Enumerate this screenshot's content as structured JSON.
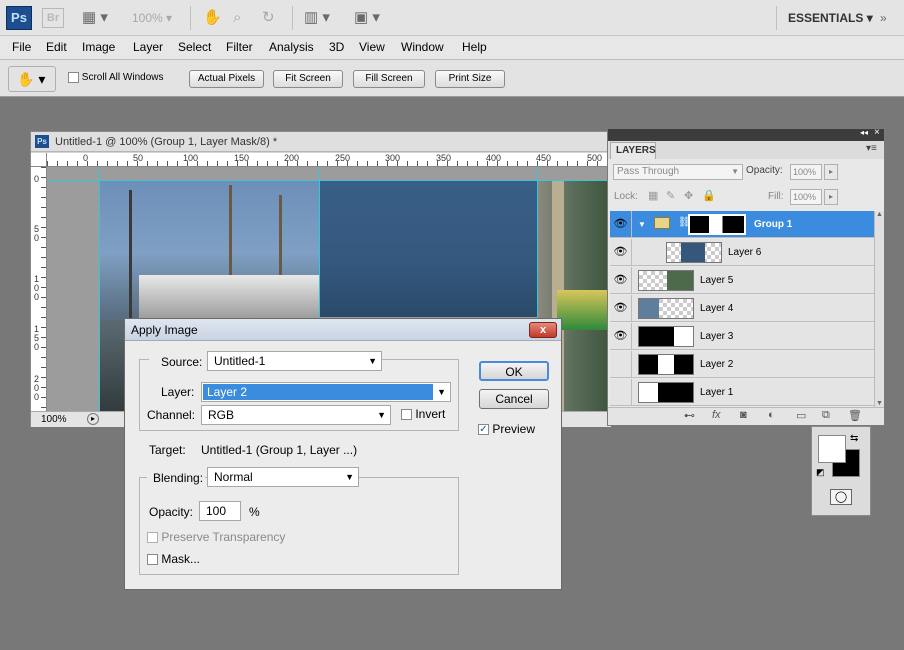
{
  "app": {
    "logo": "Ps",
    "bridge": "Br",
    "zoom": "100%",
    "workspace": "ESSENTIALS"
  },
  "menu": [
    "File",
    "Edit",
    "Image",
    "Layer",
    "Select",
    "Filter",
    "Analysis",
    "3D",
    "View",
    "Window",
    "Help"
  ],
  "options": {
    "scroll_all": "Scroll All Windows",
    "actual_pixels": "Actual Pixels",
    "fit_screen": "Fit Screen",
    "fill_screen": "Fill Screen",
    "print_size": "Print Size"
  },
  "document": {
    "title": "Untitled-1 @ 100% (Group 1, Layer Mask/8) *",
    "zoom": "100%",
    "ruler_h": [
      "0",
      "50",
      "100",
      "150",
      "200",
      "250",
      "300",
      "350",
      "400",
      "450",
      "500"
    ],
    "ruler_v": [
      "0",
      "5\n0",
      "1\n0\n0",
      "1\n5\n0",
      "2\n0\n0"
    ]
  },
  "dialog": {
    "title": "Apply Image",
    "source_label": "Source:",
    "source_value": "Untitled-1",
    "layer_label": "Layer:",
    "layer_value": "Layer 2",
    "channel_label": "Channel:",
    "channel_value": "RGB",
    "invert_label": "Invert",
    "target_label": "Target:",
    "target_value": "Untitled-1 (Group 1, Layer ...)",
    "blending_label": "Blending:",
    "blending_value": "Normal",
    "opacity_label": "Opacity:",
    "opacity_value": "100",
    "opacity_unit": "%",
    "preserve_label": "Preserve Transparency",
    "mask_label": "Mask...",
    "ok": "OK",
    "cancel": "Cancel",
    "preview_label": "Preview",
    "close": "x"
  },
  "layers_panel": {
    "tab": "LAYERS",
    "blend_mode": "Pass Through",
    "opacity_label": "Opacity:",
    "opacity_value": "100%",
    "lock_label": "Lock:",
    "fill_label": "Fill:",
    "fill_value": "100%",
    "layers": [
      {
        "name": "Group 1",
        "visible": true,
        "selected": true
      },
      {
        "name": "Layer 6",
        "visible": true,
        "selected": false
      },
      {
        "name": "Layer 5",
        "visible": true,
        "selected": false
      },
      {
        "name": "Layer 4",
        "visible": true,
        "selected": false
      },
      {
        "name": "Layer 3",
        "visible": true,
        "selected": false
      },
      {
        "name": "Layer 2",
        "visible": false,
        "selected": false
      },
      {
        "name": "Layer 1",
        "visible": false,
        "selected": false
      }
    ]
  },
  "colors": {
    "selection_blue": "#3b8cde",
    "photoshop_blue": "#1d4f8f",
    "workspace_grey": "#787878"
  }
}
